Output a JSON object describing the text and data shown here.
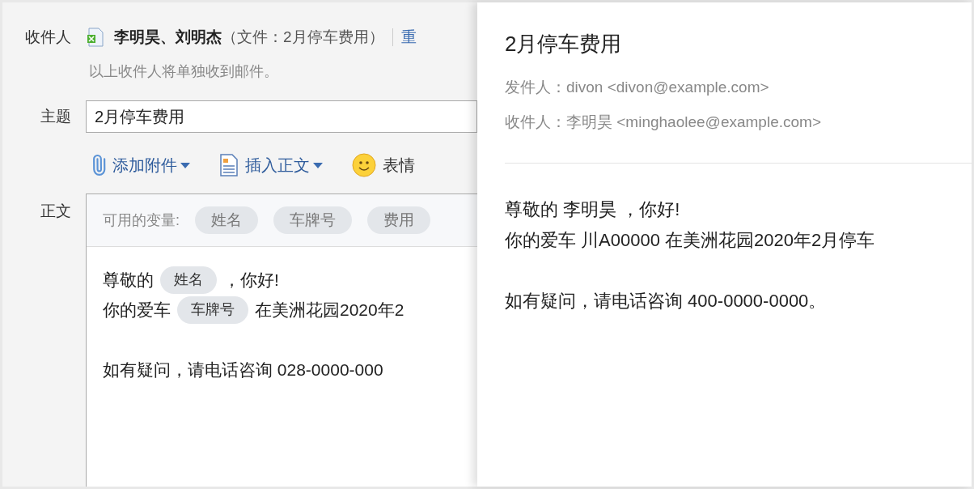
{
  "compose": {
    "recipients": {
      "label": "收件人",
      "names": "李明昊、刘明杰",
      "file_note": "（文件：2月停车费用）",
      "action": "重",
      "note": "以上收件人将单独收到邮件。"
    },
    "subject": {
      "label": "主题",
      "value": "2月停车费用"
    },
    "toolbar": [
      {
        "kind": "attach",
        "label": "添加附件",
        "dropdown": true
      },
      {
        "kind": "insert",
        "label": "插入正文",
        "dropdown": true
      },
      {
        "kind": "emoji",
        "label": "表情",
        "dropdown": false
      }
    ],
    "body": {
      "label": "正文",
      "variables_label": "可用的变量:",
      "variables": [
        "姓名",
        "车牌号",
        "费用"
      ],
      "paragraphs": [
        [
          [
            {
              "kind": "text",
              "text": "尊敬的"
            },
            {
              "kind": "var",
              "text": "姓名"
            },
            {
              "kind": "text",
              "text": "，你好!"
            }
          ],
          [
            {
              "kind": "text",
              "text": "你的爱车"
            },
            {
              "kind": "var",
              "text": "车牌号"
            },
            {
              "kind": "text",
              "text": "在美洲花园2020年2"
            }
          ]
        ],
        [
          [
            {
              "kind": "text",
              "text": "如有疑问，请电话咨询 028-0000-000"
            }
          ]
        ]
      ]
    }
  },
  "preview": {
    "title": "2月停车费用",
    "meta": [
      {
        "label": "发件人：",
        "value": "divon <divon@example.com>"
      },
      {
        "label": "收件人：",
        "value": "李明昊 <minghaolee@example.com>"
      }
    ],
    "paragraphs": [
      [
        "尊敬的 李明昊 ，你好!",
        "你的爱车 川A00000 在美洲花园2020年2月停车"
      ],
      [
        "如有疑问，请电话咨询 400-0000-0000。"
      ]
    ]
  }
}
